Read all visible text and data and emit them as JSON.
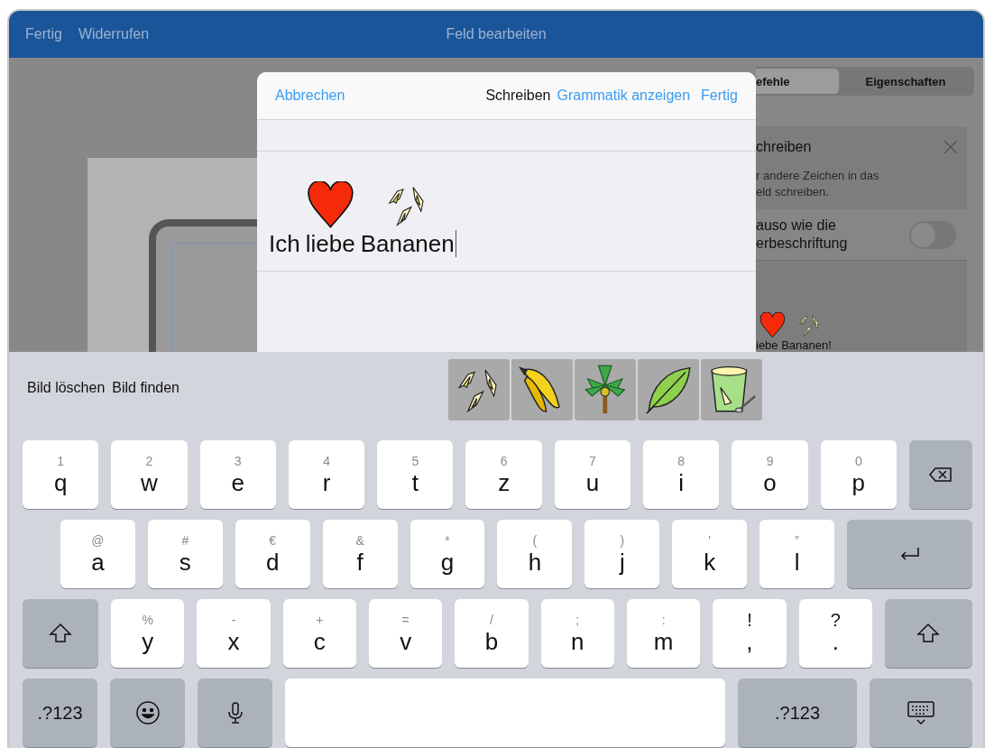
{
  "top_bar": {
    "left": [
      "Fertig",
      "Widerrufen"
    ],
    "title": "Feld bearbeiten"
  },
  "panel": {
    "segments": [
      {
        "label": "efehle",
        "selected": true
      },
      {
        "label": "Eigenschaften",
        "selected": false
      }
    ],
    "heading": "chreiben",
    "description": [
      "r andere Zeichen in das",
      "eld schreiben."
    ],
    "toggle": {
      "label": [
        "auso wie die",
        "erbeschriftung"
      ],
      "on": false
    },
    "preview": {
      "symbols": [
        {
          "kind": "heart"
        },
        {
          "kind": "bananas"
        }
      ],
      "text": "iebe Bananen!"
    }
  },
  "dialog": {
    "cancel": "Abbrechen",
    "mode": "Schreiben",
    "grammar": "Grammatik anzeigen",
    "done": "Fertig",
    "words": [
      {
        "text": "Ich"
      },
      {
        "text": "liebe",
        "symbol": {
          "kind": "heart"
        }
      },
      {
        "text": "Bananen",
        "symbol": {
          "kind": "bananas"
        }
      }
    ]
  },
  "suggestions": {
    "actions": [
      "Bild löschen",
      "Bild finden"
    ],
    "pictures": [
      {
        "kind": "bananas"
      },
      {
        "kind": "banana-bunch"
      },
      {
        "kind": "palm-tree"
      },
      {
        "kind": "leaf"
      },
      {
        "kind": "yogurt"
      }
    ]
  },
  "keyboard": [
    [
      {
        "kind": "letter",
        "hint": "1",
        "label": "q"
      },
      {
        "kind": "letter",
        "hint": "2",
        "label": "w"
      },
      {
        "kind": "letter",
        "hint": "3",
        "label": "e"
      },
      {
        "kind": "letter",
        "hint": "4",
        "label": "r"
      },
      {
        "kind": "letter",
        "hint": "5",
        "label": "t"
      },
      {
        "kind": "letter",
        "hint": "6",
        "label": "z"
      },
      {
        "kind": "letter",
        "hint": "7",
        "label": "u"
      },
      {
        "kind": "letter",
        "hint": "8",
        "label": "i"
      },
      {
        "kind": "letter",
        "hint": "9",
        "label": "o"
      },
      {
        "kind": "letter",
        "hint": "0",
        "label": "p"
      },
      {
        "kind": "backspace"
      }
    ],
    [
      {
        "kind": "letter",
        "hint": "@",
        "label": "a"
      },
      {
        "kind": "letter",
        "hint": "#",
        "label": "s"
      },
      {
        "kind": "letter",
        "hint": "€",
        "label": "d"
      },
      {
        "kind": "letter",
        "hint": "&",
        "label": "f"
      },
      {
        "kind": "letter",
        "hint": "*",
        "label": "g"
      },
      {
        "kind": "letter",
        "hint": "(",
        "label": "h"
      },
      {
        "kind": "letter",
        "hint": ")",
        "label": "j"
      },
      {
        "kind": "letter",
        "hint": "’",
        "label": "k"
      },
      {
        "kind": "letter",
        "hint": "”",
        "label": "l"
      },
      {
        "kind": "return"
      }
    ],
    [
      {
        "kind": "shift"
      },
      {
        "kind": "letter",
        "hint": "%",
        "label": "y"
      },
      {
        "kind": "letter",
        "hint": "-",
        "label": "x"
      },
      {
        "kind": "letter",
        "hint": "+",
        "label": "c"
      },
      {
        "kind": "letter",
        "hint": "=",
        "label": "v"
      },
      {
        "kind": "letter",
        "hint": "/",
        "label": "b"
      },
      {
        "kind": "letter",
        "hint": ";",
        "label": "n"
      },
      {
        "kind": "letter",
        "hint": ":",
        "label": "m"
      },
      {
        "kind": "punct",
        "hint": "!",
        "label": ","
      },
      {
        "kind": "punct",
        "hint": "?",
        "label": "."
      },
      {
        "kind": "shift"
      }
    ],
    [
      {
        "kind": "mode",
        "label": ".?123"
      },
      {
        "kind": "emoji"
      },
      {
        "kind": "mic"
      },
      {
        "kind": "space"
      },
      {
        "kind": "mode",
        "label": ".?123"
      },
      {
        "kind": "hide"
      }
    ]
  ]
}
